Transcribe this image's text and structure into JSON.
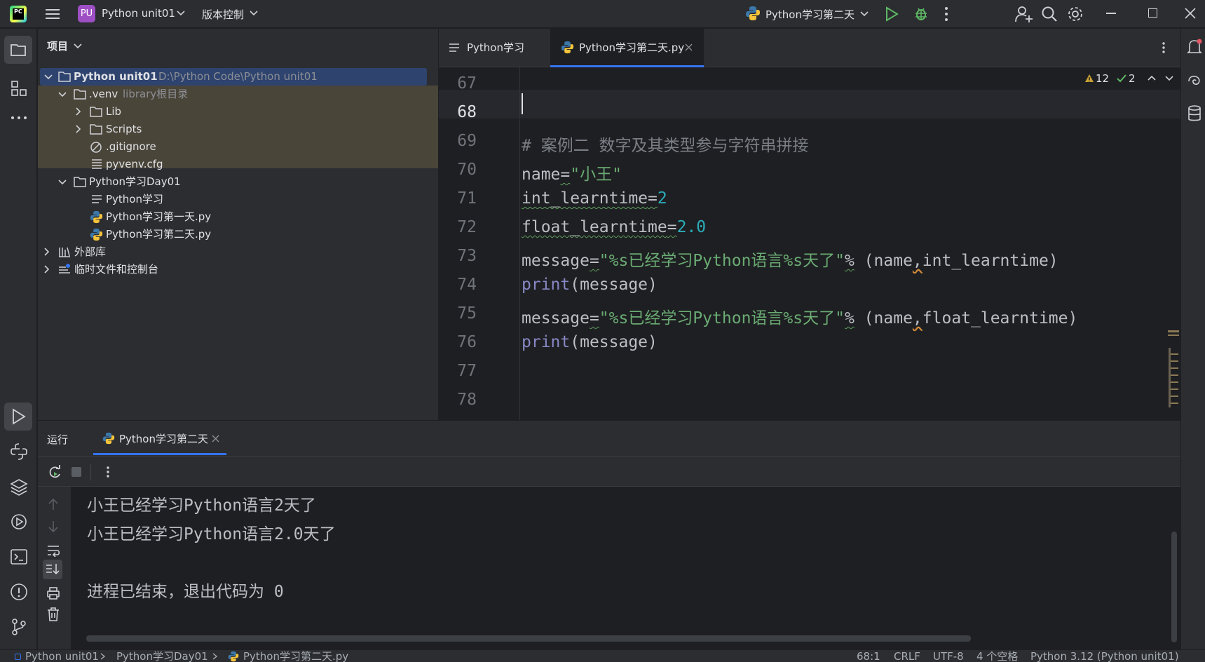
{
  "titlebar": {
    "project_badge": "PU",
    "project_name": "Python unit01",
    "vcs_label": "版本控制",
    "run_config": "Python学习第二天"
  },
  "project_panel": {
    "title": "项目",
    "tree": [
      {
        "label": "Python unit01",
        "path": "D:\\Python Code\\Python unit01"
      },
      {
        "label": ".venv",
        "note": "library根目录"
      },
      {
        "label": "Lib"
      },
      {
        "label": "Scripts"
      },
      {
        "label": ".gitignore"
      },
      {
        "label": "pyvenv.cfg"
      },
      {
        "label": "Python学习Day01"
      },
      {
        "label": "Python学习"
      },
      {
        "label": "Python学习第一天.py"
      },
      {
        "label": "Python学习第二天.py"
      },
      {
        "label": "外部库"
      },
      {
        "label": "临时文件和控制台"
      }
    ]
  },
  "editor": {
    "tabs": [
      {
        "label": "Python学习"
      },
      {
        "label": "Python学习第二天.py"
      }
    ],
    "warnings_count": "12",
    "ok_count": "2",
    "line_numbers": [
      "67",
      "68",
      "69",
      "70",
      "71",
      "72",
      "73",
      "74",
      "75",
      "76",
      "77",
      "78"
    ],
    "code": {
      "l69": "# 案例二 数字及其类型参与字符串拼接",
      "l70_a": "name",
      "l70_b": "=",
      "l70_c": "\"小王\"",
      "l71_a": "int_learntime",
      "l71_b": "=",
      "l71_c": "2",
      "l72_a": "float_learntime",
      "l72_b": "=",
      "l72_c": "2.0",
      "l73_a": "message",
      "l73_b": "=",
      "l73_c": "\"%s已经学习Python语言%s天了\"",
      "l73_d": "%",
      "l73_e": " (name",
      "l73_f": ",",
      "l73_g": "int_learntime)",
      "l74_a": "print",
      "l74_b": "(message)",
      "l75_a": "message",
      "l75_b": "=",
      "l75_c": "\"%s已经学习Python语言%s天了\"",
      "l75_d": "%",
      "l75_e": " (name",
      "l75_f": ",",
      "l75_g": "float_learntime)",
      "l76_a": "print",
      "l76_b": "(message)"
    }
  },
  "run_panel": {
    "title": "运行",
    "tab": "Python学习第二天",
    "output": [
      "小王已经学习Python语言2天了",
      "小王已经学习Python语言2.0天了",
      "",
      "进程已结束，退出代码为 0"
    ]
  },
  "statusbar": {
    "crumbs": [
      "Python unit01",
      "Python学习Day01",
      "Python学习第二天.py"
    ],
    "position": "68:1",
    "line_sep": "CRLF",
    "encoding": "UTF-8",
    "indent": "4 个空格",
    "interpreter": "Python 3.12 (Python unit01)"
  },
  "colors": {
    "bg": "#1e1f22",
    "panel": "#2b2d30",
    "accent": "#3574f0",
    "string": "#6aab73",
    "number": "#2aacb8",
    "keyword_fn": "#8888c6",
    "comment": "#7a7e85"
  }
}
